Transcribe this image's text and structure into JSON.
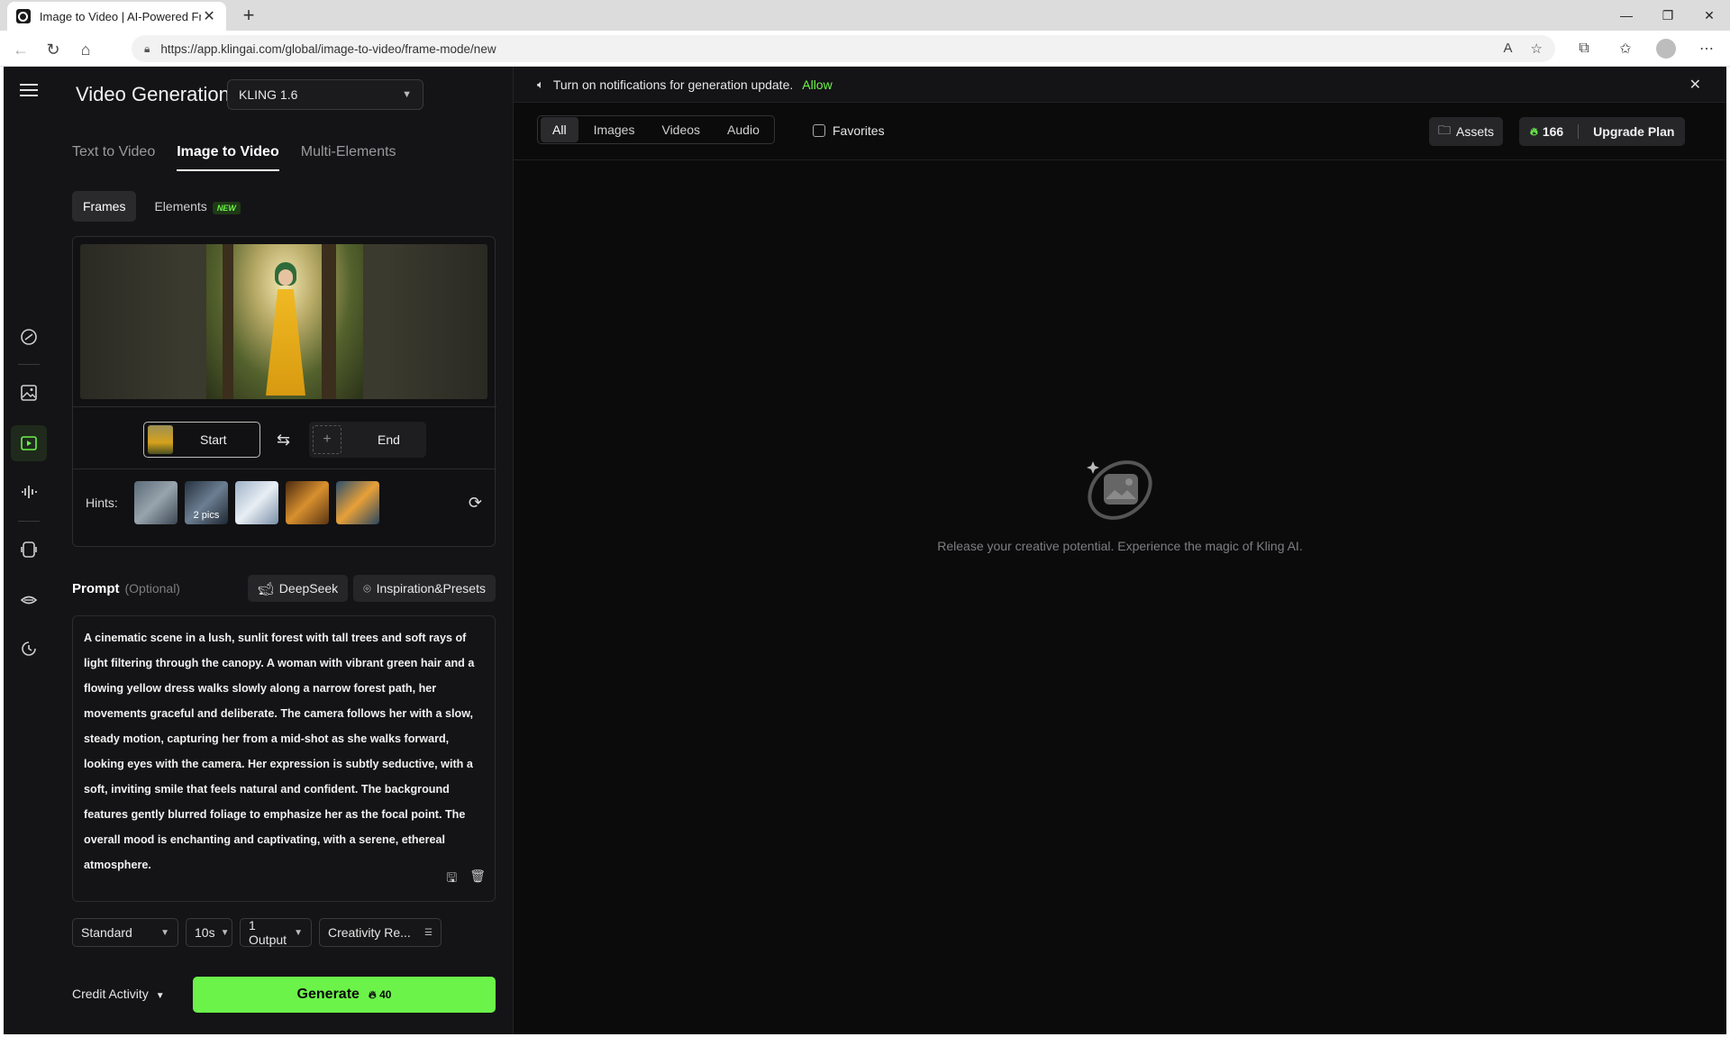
{
  "browser": {
    "tab_title": "Image to Video | AI-Powered Fran",
    "url": "https://app.klingai.com/global/image-to-video/frame-mode/new"
  },
  "notification": {
    "text": "Turn on notifications for generation update.",
    "allow": "Allow"
  },
  "panel": {
    "title": "Video Generation",
    "model": "KLING 1.6",
    "mode_tabs": [
      "Text to Video",
      "Image to Video",
      "Multi-Elements"
    ],
    "sub_tabs": {
      "frames": "Frames",
      "elements": "Elements",
      "new_badge": "NEW"
    },
    "start_label": "Start",
    "end_label": "End",
    "hints_label": "Hints:",
    "hint_count": "2 pics",
    "prompt_title": "Prompt",
    "prompt_optional": "(Optional)",
    "deepseek": "DeepSeek",
    "inspiration": "Inspiration&Presets",
    "prompt_text": "A cinematic scene in a lush, sunlit forest with tall trees and soft rays of light filtering through the canopy. A woman with vibrant green hair and a flowing yellow dress walks slowly along a narrow forest path, her movements graceful and deliberate. The camera follows her with a slow, steady motion, capturing her from a mid-shot as she walks forward, looking eyes with the camera. Her expression is subtly seductive, with a soft, inviting smile that feels natural and confident. The background features gently blurred foliage to emphasize her as the focal point. The overall mood is enchanting and captivating, with a serene, ethereal atmosphere.",
    "options": {
      "quality": "Standard",
      "duration": "10s",
      "outputs": "1 Output",
      "creativity": "Creativity Re..."
    },
    "credit_activity": "Credit Activity",
    "generate": "Generate",
    "generate_cost": "40"
  },
  "filters": {
    "tabs": [
      "All",
      "Images",
      "Videos",
      "Audio"
    ],
    "favorites": "Favorites",
    "assets": "Assets",
    "credits": "166",
    "upgrade": "Upgrade Plan"
  },
  "empty_state": {
    "text": "Release your creative potential. Experience the magic of Kling AI."
  },
  "colors": {
    "accent": "#6cf34a",
    "bg": "#0b0b0c",
    "panel": "#141416"
  }
}
